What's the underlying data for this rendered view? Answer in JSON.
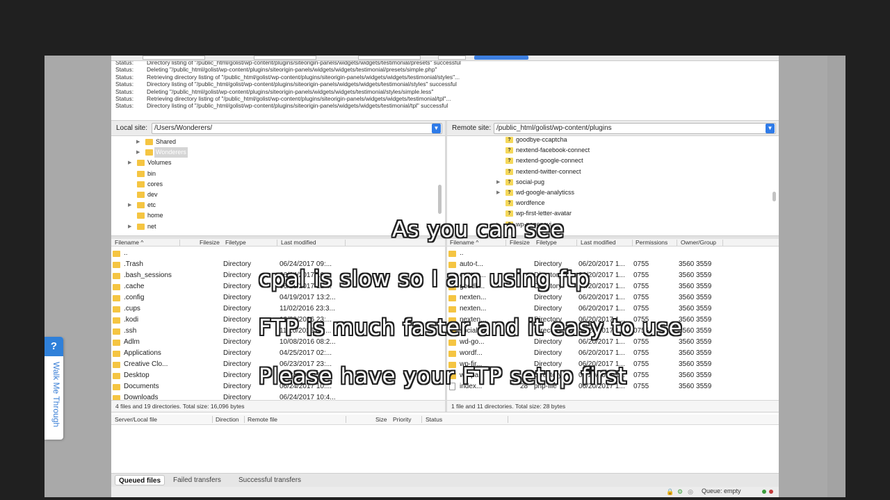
{
  "log": [
    {
      "label": "Status:",
      "msg": "Directory listing of \"/public_html/golist/wp-content/plugins/siteorigin-panels/widgets/widgets/testimonial/presets\" successful"
    },
    {
      "label": "Status:",
      "msg": "Deleting \"/public_html/golist/wp-content/plugins/siteorigin-panels/widgets/widgets/testimonial/presets/simple.php\""
    },
    {
      "label": "Status:",
      "msg": "Retrieving directory listing of \"/public_html/golist/wp-content/plugins/siteorigin-panels/widgets/widgets/testimonial/styles\"..."
    },
    {
      "label": "Status:",
      "msg": "Directory listing of \"/public_html/golist/wp-content/plugins/siteorigin-panels/widgets/widgets/testimonial/styles\" successful"
    },
    {
      "label": "Status:",
      "msg": "Deleting \"/public_html/golist/wp-content/plugins/siteorigin-panels/widgets/widgets/testimonial/styles/simple.less\""
    },
    {
      "label": "Status:",
      "msg": "Retrieving directory listing of \"/public_html/golist/wp-content/plugins/siteorigin-panels/widgets/widgets/testimonial/tpl\"..."
    },
    {
      "label": "Status:",
      "msg": "Directory listing of \"/public_html/golist/wp-content/plugins/siteorigin-panels/widgets/widgets/testimonial/tpl\" successful"
    }
  ],
  "local": {
    "label": "Local site:",
    "path": "/Users/Wonderers/",
    "tree": [
      {
        "name": "Shared",
        "arrow": "▶",
        "indent": 1
      },
      {
        "name": "Wonderers",
        "arrow": "▶",
        "indent": 1,
        "selected": true
      },
      {
        "name": "Volumes",
        "arrow": "▶",
        "indent": 0
      },
      {
        "name": "bin",
        "arrow": "",
        "indent": 0
      },
      {
        "name": "cores",
        "arrow": "",
        "indent": 0
      },
      {
        "name": "dev",
        "arrow": "",
        "indent": 0
      },
      {
        "name": "etc",
        "arrow": "▶",
        "indent": 0
      },
      {
        "name": "home",
        "arrow": "",
        "indent": 0
      },
      {
        "name": "net",
        "arrow": "▶",
        "indent": 0
      }
    ],
    "headers": {
      "filename": "Filename ^",
      "filesize": "Filesize",
      "filetype": "Filetype",
      "modified": "Last modified"
    },
    "files": [
      {
        "name": "..",
        "type": "",
        "modified": ""
      },
      {
        "name": ".Trash",
        "type": "Directory",
        "modified": "06/24/2017 09:..."
      },
      {
        "name": ".bash_sessions",
        "type": "Directory",
        "modified": "06/24/2017 10:..."
      },
      {
        "name": ".cache",
        "type": "Directory",
        "modified": "06/21/2017 12:..."
      },
      {
        "name": ".config",
        "type": "Directory",
        "modified": "04/19/2017 13:2..."
      },
      {
        "name": ".cups",
        "type": "Directory",
        "modified": "11/02/2016 23:3..."
      },
      {
        "name": ".kodi",
        "type": "Directory",
        "modified": "10/29/2016 23:..."
      },
      {
        "name": ".ssh",
        "type": "Directory",
        "modified": "11/10/2016 04:..."
      },
      {
        "name": "Adlm",
        "type": "Directory",
        "modified": "10/08/2016 08:2..."
      },
      {
        "name": "Applications",
        "type": "Directory",
        "modified": "04/25/2017 02:..."
      },
      {
        "name": "Creative Clo...",
        "type": "Directory",
        "modified": "06/23/2017 23:..."
      },
      {
        "name": "Desktop",
        "type": "Directory",
        "modified": "06/24/2017 10:..."
      },
      {
        "name": "Documents",
        "type": "Directory",
        "modified": "06/24/2017 10:..."
      },
      {
        "name": "Downloads",
        "type": "Directory",
        "modified": "06/24/2017 10:4..."
      }
    ],
    "status": "4 files and 19 directories. Total size: 16,096 bytes"
  },
  "remote": {
    "label": "Remote site:",
    "path": "/public_html/golist/wp-content/plugins",
    "tree": [
      {
        "name": "goodbye-ccaptcha",
        "arrow": ""
      },
      {
        "name": "nextend-facebook-connect",
        "arrow": ""
      },
      {
        "name": "nextend-google-connect",
        "arrow": ""
      },
      {
        "name": "nextend-twitter-connect",
        "arrow": ""
      },
      {
        "name": "social-pug",
        "arrow": "▶"
      },
      {
        "name": "wd-google-analyticss",
        "arrow": "▶"
      },
      {
        "name": "wordfence",
        "arrow": ""
      },
      {
        "name": "wp-first-letter-avatar",
        "arrow": ""
      },
      {
        "name": "wp-pagenavi",
        "arrow": "▶"
      }
    ],
    "headers": {
      "filename": "Filename ^",
      "filesize": "Filesize",
      "filetype": "Filetype",
      "modified": "Last modified",
      "permissions": "Permissions",
      "owner": "Owner/Group"
    },
    "files": [
      {
        "name": "..",
        "size": "",
        "type": "",
        "modified": "",
        "perm": "",
        "owner": "",
        "file": false
      },
      {
        "name": "auto-t...",
        "size": "",
        "type": "Directory",
        "modified": "06/20/2017 1...",
        "perm": "0755",
        "owner": "3560 3559",
        "file": false
      },
      {
        "name": "contac...",
        "size": "",
        "type": "Directory",
        "modified": "06/20/2017 1...",
        "perm": "0755",
        "owner": "3560 3559",
        "file": false
      },
      {
        "name": "goodb...",
        "size": "",
        "type": "Directory",
        "modified": "06/20/2017 1...",
        "perm": "0755",
        "owner": "3560 3559",
        "file": false
      },
      {
        "name": "nexten...",
        "size": "",
        "type": "Directory",
        "modified": "06/20/2017 1...",
        "perm": "0755",
        "owner": "3560 3559",
        "file": false
      },
      {
        "name": "nexten...",
        "size": "",
        "type": "Directory",
        "modified": "06/20/2017 1...",
        "perm": "0755",
        "owner": "3560 3559",
        "file": false
      },
      {
        "name": "nexten...",
        "size": "",
        "type": "Directory",
        "modified": "06/20/2017 1...",
        "perm": "0755",
        "owner": "3560 3559",
        "file": false
      },
      {
        "name": "social...",
        "size": "",
        "type": "Directory",
        "modified": "06/20/2017 1...",
        "perm": "0755",
        "owner": "3560 3559",
        "file": false
      },
      {
        "name": "wd-go...",
        "size": "",
        "type": "Directory",
        "modified": "06/20/2017 1...",
        "perm": "0755",
        "owner": "3560 3559",
        "file": false
      },
      {
        "name": "wordf...",
        "size": "",
        "type": "Directory",
        "modified": "06/20/2017 1...",
        "perm": "0755",
        "owner": "3560 3559",
        "file": false
      },
      {
        "name": "wp-fir...",
        "size": "",
        "type": "Directory",
        "modified": "06/20/2017 1...",
        "perm": "0755",
        "owner": "3560 3559",
        "file": false
      },
      {
        "name": "wp-pa...",
        "size": "",
        "type": "Directory",
        "modified": "06/20/2017 1...",
        "perm": "0755",
        "owner": "3560 3559",
        "file": false
      },
      {
        "name": "index...",
        "size": "28",
        "type": "php-file",
        "modified": "06/20/2017 1...",
        "perm": "0755",
        "owner": "3560 3559",
        "file": true
      }
    ],
    "status": "1 file and 11 directories. Total size: 28 bytes"
  },
  "queue": {
    "headers": {
      "server": "Server/Local file",
      "direction": "Direction",
      "remote": "Remote file",
      "size": "Size",
      "priority": "Priority",
      "status": "Status"
    }
  },
  "tabs": [
    {
      "label": "Queued files",
      "active": true
    },
    {
      "label": "Failed transfers",
      "active": false
    },
    {
      "label": "Successful transfers",
      "active": false
    }
  ],
  "statusbar": {
    "queue": "Queue: empty"
  },
  "walkme": {
    "q": "?",
    "text": "Walk Me Through"
  },
  "captions": [
    "As you can see",
    "cpal is slow so I am using ftp",
    "FTP is much faster and it easy to use",
    "Please have your FTP setup first"
  ],
  "colors": {
    "accent": "#2f7be8",
    "folder": "#f5c542",
    "walkme": "#2f80d9"
  }
}
